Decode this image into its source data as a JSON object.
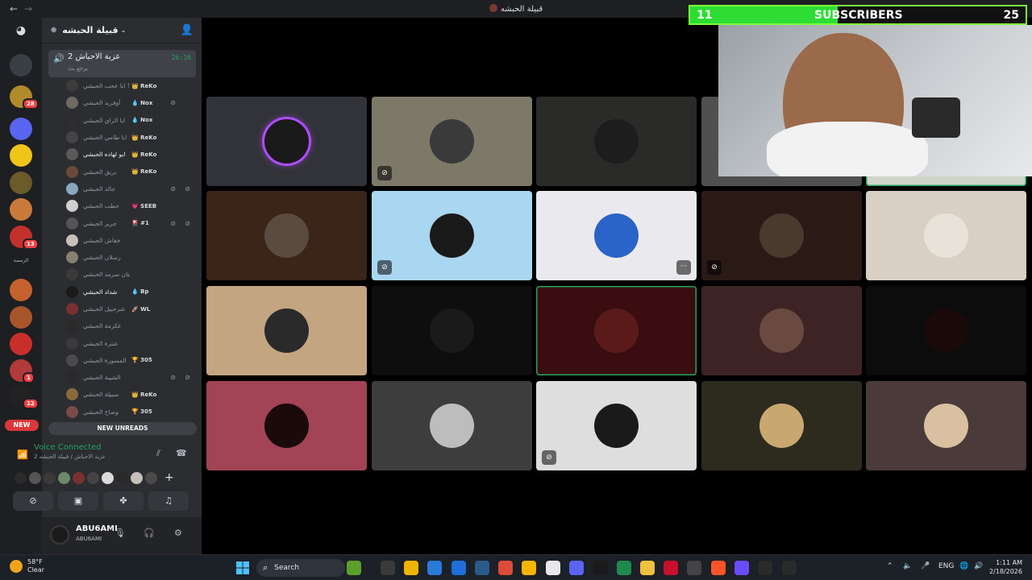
{
  "window": {
    "title": "قبيلة الحبشه",
    "back_icon": "arrow-left-icon",
    "forward_icon": "arrow-right-icon"
  },
  "servers": [
    {
      "color": "#3a3f46"
    },
    {
      "color": "#b08b2a",
      "badge": "28"
    },
    {
      "color": "#5865f2"
    },
    {
      "color": "#f0c419"
    },
    {
      "color": "#6b5a2a"
    },
    {
      "color": "#c97a3a"
    },
    {
      "color": "#c4302b",
      "badge": "13"
    },
    {
      "color": "#c4622d"
    },
    {
      "color": "#a8552a"
    },
    {
      "color": "#c9302c"
    },
    {
      "color": "#b23a3a",
      "badge": "1"
    },
    {
      "color": "#222222",
      "badge": "12"
    }
  ],
  "server_text_label": "الرسمة",
  "new_pill": "NEW",
  "guild": {
    "name": "قبيلة الحبشه"
  },
  "voice_channel": {
    "name": "عزبة الاحباش 2",
    "time": "26:16",
    "sub": "يرجع بث"
  },
  "members": [
    {
      "name": "ابا عجب الحبشي !",
      "tag": "👑 ReKo",
      "color": "#3c3c3c"
    },
    {
      "name": "أوفريد الحبشي",
      "tag": "💧 Nox",
      "color": "#6e6a60",
      "mic": true
    },
    {
      "name": "ابا الراي الحبشي",
      "tag": "💧 Nox",
      "color": "#2f2f2f"
    },
    {
      "name": "ابا طامي الحبشي",
      "tag": "👑 ReKo",
      "color": "#444444"
    },
    {
      "name": "ابو لهاده الحبشي",
      "tag": "👑 ReKo",
      "color": "#5a5a5a",
      "bright": true
    },
    {
      "name": "بريق الحبشي",
      "tag": "👑 ReKo",
      "color": "#6a4a3a"
    },
    {
      "name": "جالد الحبشي",
      "tag": "",
      "color": "#8aa6c0",
      "mic": true,
      "sound": true
    },
    {
      "name": "حطب الحبشي",
      "tag": "💗 SEEB",
      "color": "#d0d0d0"
    },
    {
      "name": "جرير الحبشي",
      "tag": "🎴 #1",
      "color": "#555555",
      "mic": true,
      "sound": true
    },
    {
      "name": "خفاش الحبشي",
      "tag": "",
      "color": "#c8c0b8"
    },
    {
      "name": "رسلان الحبشي",
      "tag": "",
      "color": "#888070"
    },
    {
      "name": "زلتان سرمد الحبشي",
      "tag": "",
      "color": "#3a3a3a"
    },
    {
      "name": "شداد الحبشي",
      "tag": "💧 Bp",
      "color": "#1a1a1a",
      "bright": true
    },
    {
      "name": "شرحبيل الحبشي",
      "tag": "🚀 WL",
      "color": "#7a3030"
    },
    {
      "name": "عكرمة الحبشي",
      "tag": "",
      "color": "#2a2a2a"
    },
    {
      "name": "عنترة الحبشي",
      "tag": "",
      "color": "#3a3a3a"
    },
    {
      "name": "المسورة الحبشي",
      "tag": "🏆 305",
      "color": "#4a4a4a"
    },
    {
      "name": "الشيبة الحبشي",
      "tag": "",
      "color": "#2a2a2a",
      "mic": true,
      "sound": true
    },
    {
      "name": "سبيلة الحبشي",
      "tag": "👑 ReKo",
      "color": "#8a6a3a"
    },
    {
      "name": "وضاح الحبشي",
      "tag": "🏆 305",
      "color": "#7a4a4a"
    }
  ],
  "new_unreads": "NEW UNREADS",
  "voice_status": {
    "title": "Voice Connected",
    "sub": "عزبة الاحباش / قبيلة الحبشه 2",
    "avatar_colors": [
      "#2a2a2a",
      "#555555",
      "#3a3a3a",
      "#6a8a6a",
      "#7a3030",
      "#444444",
      "#dcdcdc",
      "#2a2a2a",
      "#c8c0b8",
      "#4a4a4a"
    ],
    "buttons": [
      "camera-off-icon",
      "screen-share-icon",
      "activities-icon",
      "soundboard-icon"
    ]
  },
  "user": {
    "name": "ABU6AMI",
    "status": "ABU6AMI"
  },
  "tiles": [
    {
      "bg": "#313338",
      "av": "#1a1a1a",
      "ring": "#b04cff"
    },
    {
      "bg": "#7d7968",
      "av": "#3a3a3a",
      "mute": "mic-off-icon"
    },
    {
      "bg": "#2a2b29",
      "av": "#1d1d1d"
    },
    {
      "bg": "#505050",
      "av": "#3a3a3a"
    },
    {
      "bg": "#cfd6c9",
      "av": "#a0a0a0",
      "speaking": true
    },
    {
      "bg": "#3b2418",
      "av": "#5a4a40"
    },
    {
      "bg": "#a9d6f0",
      "av": "#1a1a1a",
      "mute": "sound-off-icon"
    },
    {
      "bg": "#eaeaee",
      "av": "#2a64c8",
      "more": "more-icon"
    },
    {
      "bg": "#2a1a16",
      "av": "#4a3a2e",
      "mute": "sound-off-icon"
    },
    {
      "bg": "#d8d0c4",
      "av": "#e8e2d8"
    },
    {
      "bg": "#c4a582",
      "av": "#2a2a2a"
    },
    {
      "bg": "#0e0e0e",
      "av": "#1a1a1a"
    },
    {
      "bg": "#3a0d10",
      "av": "#5a1a1a",
      "speaking": true
    },
    {
      "bg": "#3d2324",
      "av": "#6a4a40"
    },
    {
      "bg": "#0c0c0c",
      "av": "#1a0a0a"
    },
    {
      "bg": "#a34356",
      "av": "#1a0a0a"
    },
    {
      "bg": "#3d3d3d",
      "av": "#bdbdbd"
    },
    {
      "bg": "#dedede",
      "av": "#1a1a1a",
      "mute": "sound-off-icon"
    },
    {
      "bg": "#2d2b1e",
      "av": "#c8a870"
    },
    {
      "bg": "#4a3a3a",
      "av": "#d8c0a0"
    }
  ],
  "subscriber_goal": {
    "current": "11",
    "label": "SUBSCRIBERS",
    "goal": "25",
    "progress": 0.44
  },
  "taskbar": {
    "weather_temp": "58°F",
    "weather_desc": "Clear",
    "search_label": "Search",
    "lang": "ENG",
    "time": "1:11 AM",
    "date": "2/18/2026",
    "app_colors": [
      "#5aa02c",
      "#3a3a3a",
      "#f0b400",
      "#2a7ad8",
      "#1e6fd8",
      "#2a5a8a",
      "#dd4b39",
      "#f7b500",
      "#e8e8e8",
      "#5865f2",
      "#1a1a1a",
      "#1f8a4e",
      "#f0c040",
      "#c8102e",
      "#444444",
      "#fb542b",
      "#6a4cff",
      "#2a2a2a",
      "#2a2a2a"
    ]
  }
}
